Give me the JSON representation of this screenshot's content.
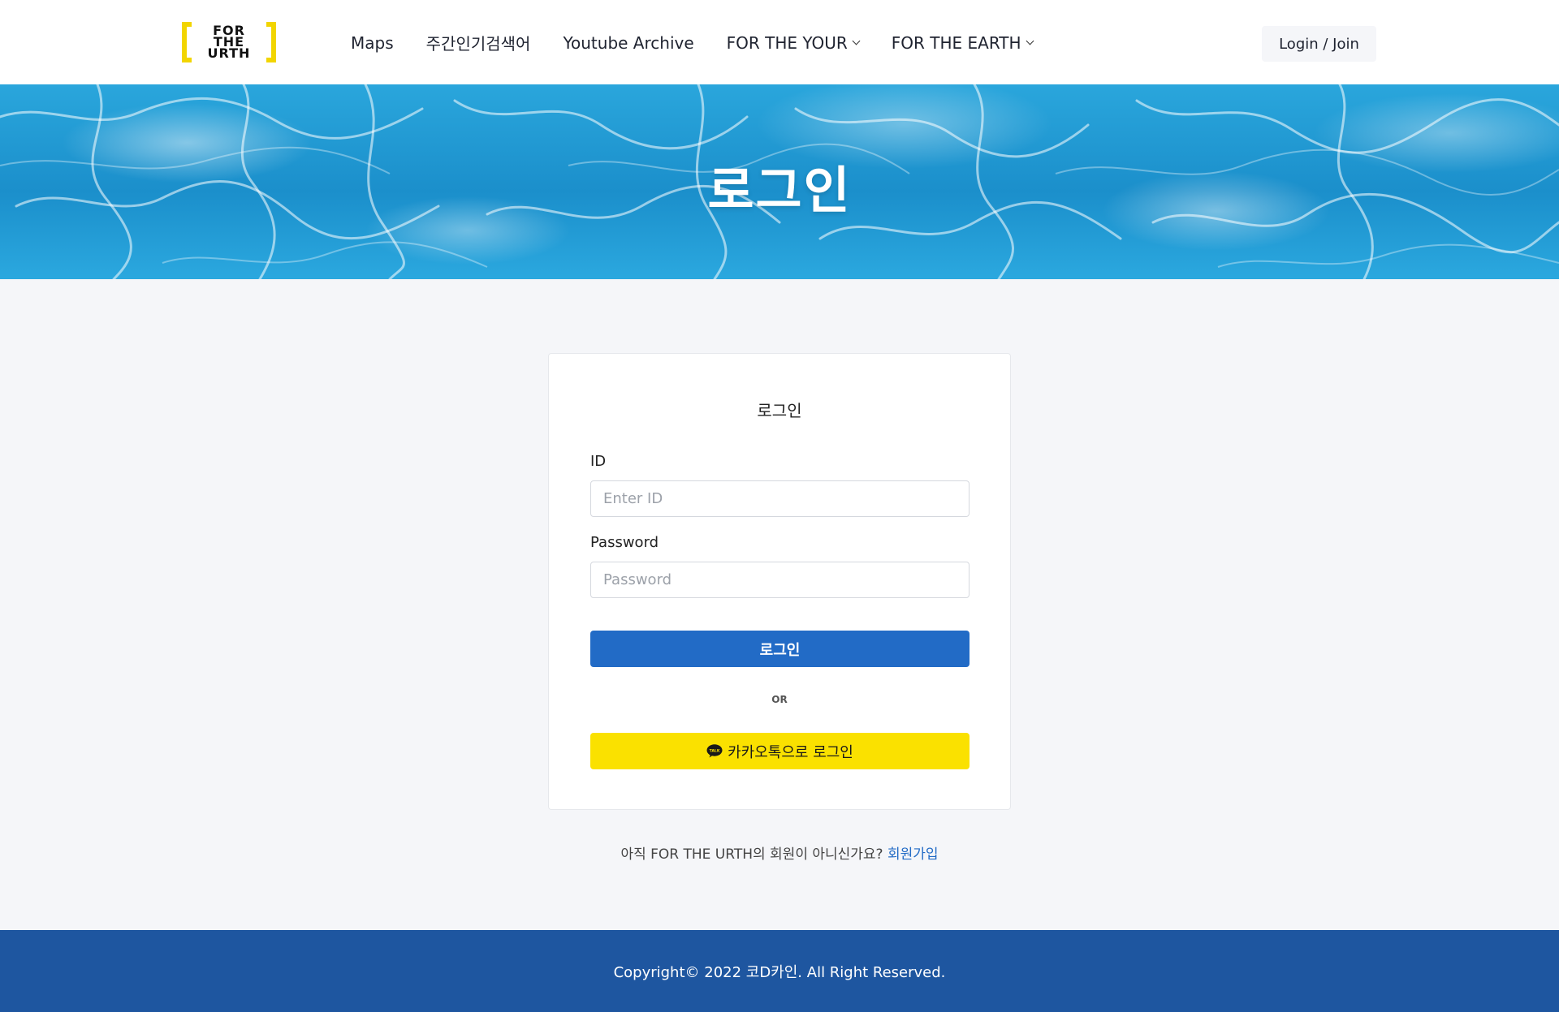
{
  "header": {
    "logo": {
      "line1": "FOR",
      "line2": "THE",
      "line3": "URTH"
    },
    "nav": [
      {
        "label": "Maps",
        "has_dropdown": false
      },
      {
        "label": "주간인기검색어",
        "has_dropdown": false
      },
      {
        "label": "Youtube Archive",
        "has_dropdown": false
      },
      {
        "label": "FOR THE YOUR",
        "has_dropdown": true
      },
      {
        "label": "FOR THE EARTH",
        "has_dropdown": true
      }
    ],
    "login_join_label": "Login / Join"
  },
  "hero": {
    "title": "로그인"
  },
  "login_card": {
    "title": "로그인",
    "id_label": "ID",
    "id_placeholder": "Enter ID",
    "id_value": "",
    "password_label": "Password",
    "password_placeholder": "Password",
    "password_value": "",
    "submit_label": "로그인",
    "or_label": "OR",
    "kakao_label": "카카오톡으로 로그인",
    "kakao_icon": "kakao-talk-bubble-icon",
    "kakao_icon_text": "TALK"
  },
  "signup": {
    "prompt": "아직 FOR THE URTH의 회원이 아니신가요? ",
    "link_label": "회원가입"
  },
  "footer": {
    "copyright": "Copyright© 2022 코D카인. All Right Reserved."
  },
  "colors": {
    "primary_button": "#226bc6",
    "kakao_button": "#fae100",
    "footer_bg": "#1e56a0",
    "logo_yellow": "#f2d500",
    "page_bg": "#f5f6f9"
  }
}
